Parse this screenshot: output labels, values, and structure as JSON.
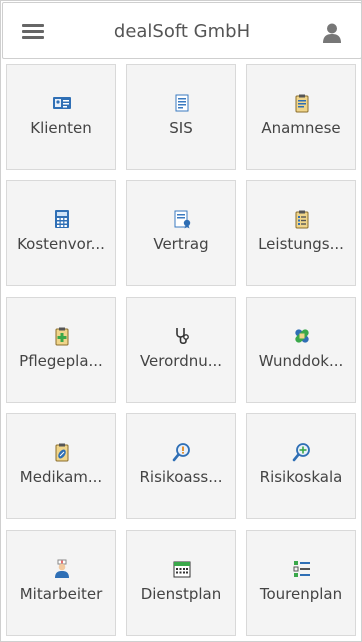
{
  "header": {
    "title": "dealSoft GmbH",
    "menu_icon": "hamburger-menu-icon",
    "user_icon": "user-icon"
  },
  "tiles": [
    {
      "label": "Klienten",
      "icon": "client-card-icon"
    },
    {
      "label": "SIS",
      "icon": "document-icon"
    },
    {
      "label": "Anamnese",
      "icon": "clipboard-icon"
    },
    {
      "label": "Kostenvor...",
      "icon": "calculator-icon"
    },
    {
      "label": "Vertrag",
      "icon": "contract-icon"
    },
    {
      "label": "Leistungs...",
      "icon": "clipboard-list-icon"
    },
    {
      "label": "Pflegepla...",
      "icon": "medical-clipboard-icon"
    },
    {
      "label": "Verordnu...",
      "icon": "stethoscope-icon"
    },
    {
      "label": "Wunddok...",
      "icon": "bandage-icon"
    },
    {
      "label": "Medikam...",
      "icon": "medication-clipboard-icon"
    },
    {
      "label": "Risikoass...",
      "icon": "magnifier-warning-icon"
    },
    {
      "label": "Risikoskala",
      "icon": "magnifier-plus-icon"
    },
    {
      "label": "Mitarbeiter",
      "icon": "nurse-icon"
    },
    {
      "label": "Dienstplan",
      "icon": "calendar-icon"
    },
    {
      "label": "Tourenplan",
      "icon": "checklist-icon"
    }
  ]
}
